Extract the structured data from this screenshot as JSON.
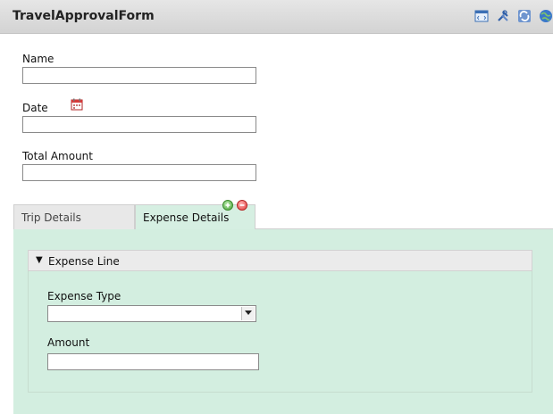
{
  "header": {
    "title": "TravelApprovalForm",
    "icons": [
      "code-view-icon",
      "tools-icon",
      "refresh-icon",
      "globe-icon"
    ]
  },
  "form": {
    "name": {
      "label": "Name",
      "value": ""
    },
    "date": {
      "label": "Date",
      "value": "",
      "icon": "calendar-icon"
    },
    "total_amount": {
      "label": "Total Amount",
      "value": ""
    }
  },
  "tabs": [
    {
      "label": "Trip Details",
      "active": false
    },
    {
      "label": "Expense Details",
      "active": true
    }
  ],
  "tab_actions": {
    "add_icon": "add-circle-icon",
    "remove_icon": "remove-circle-icon"
  },
  "expense_line": {
    "header": "Expense Line",
    "expanded": true,
    "expense_type": {
      "label": "Expense Type",
      "value": ""
    },
    "amount": {
      "label": "Amount",
      "value": ""
    }
  },
  "colors": {
    "panel_bg": "#d3eee0",
    "titlebar_bg": "#dcdcdc",
    "add": "#4aa43a",
    "remove": "#e23b3b"
  }
}
